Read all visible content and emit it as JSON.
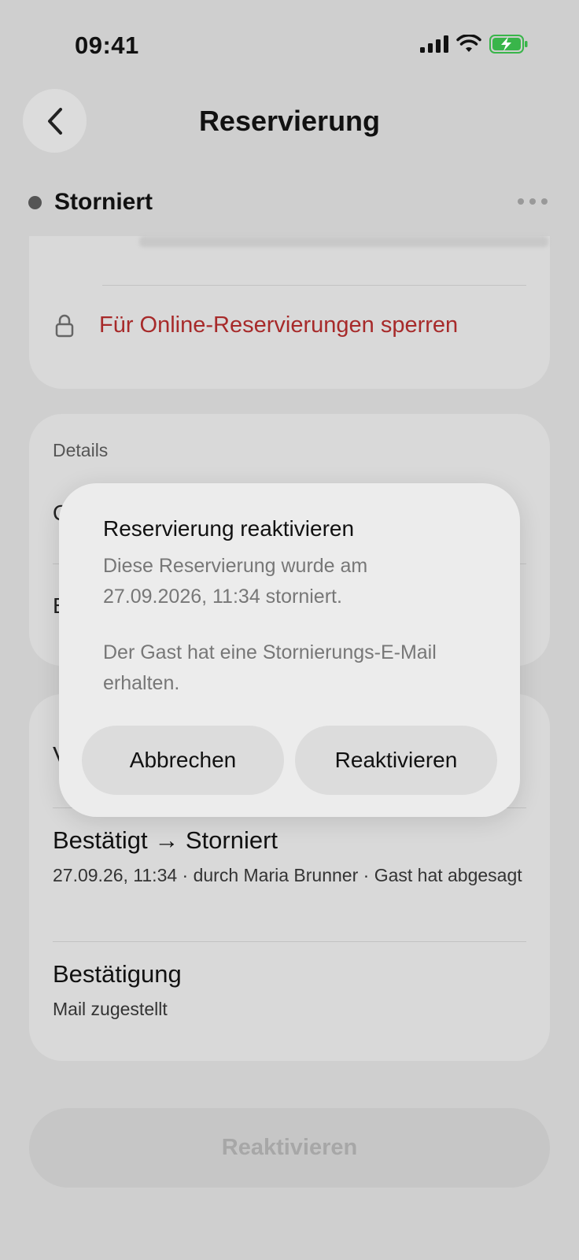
{
  "status_bar": {
    "time": "09:41"
  },
  "header": {
    "title": "Reservierung"
  },
  "reservation": {
    "status": "Storniert"
  },
  "actions_card": {
    "lock_label": "Für Online-Reservierungen sperren"
  },
  "details_card": {
    "heading": "Details",
    "row1_char": "Q",
    "row2_char": "E"
  },
  "history_card": {
    "section_char": "V",
    "entries": [
      {
        "title": "Bestätigt → Storniert",
        "subtitle": "27.09.26, 11:34 · durch Maria Brunner · Gast hat abgesagt"
      },
      {
        "title": "Bestätigung",
        "subtitle": "Mail zugestellt"
      }
    ]
  },
  "bottom_button": {
    "label": "Reaktivieren"
  },
  "dialog": {
    "title": "Reservierung reaktivieren",
    "body_1": "Diese Reservierung wurde am 27.09.2026, 11:34 storniert.",
    "body_2": "Der Gast hat eine Stornierungs-E-Mail erhalten.",
    "cancel_label": "Abbrechen",
    "confirm_label": "Reaktivieren"
  },
  "colors": {
    "danger": "#a72a2a",
    "overlay": "#cfcfcf"
  }
}
